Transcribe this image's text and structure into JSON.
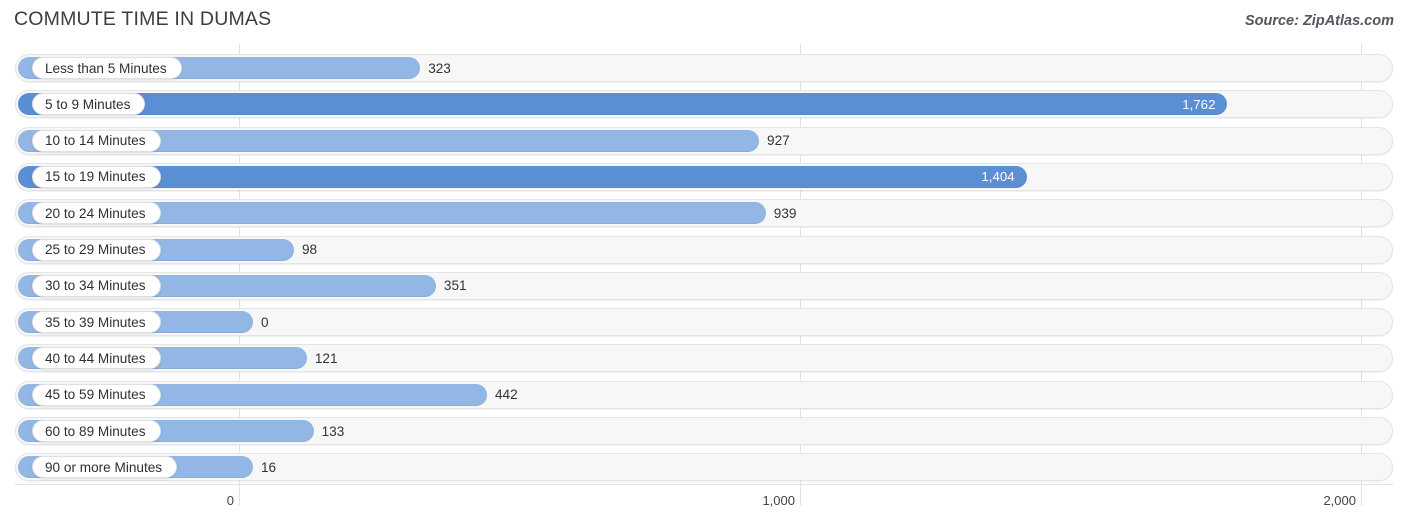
{
  "header": {
    "title": "COMMUTE TIME IN DUMAS",
    "source": "Source: ZipAtlas.com"
  },
  "colors": {
    "bar_light": "#92b7e4",
    "bar_dark": "#5b8fd4",
    "track_bg": "#f7f7f8",
    "track_border": "#e4e4e6",
    "grid": "#e2e2e4",
    "text": "#33333a",
    "title": "#3c3c44"
  },
  "chart_data": {
    "type": "bar",
    "orientation": "horizontal",
    "title": "COMMUTE TIME IN DUMAS",
    "xlabel": "",
    "ylabel": "",
    "xlim": [
      0,
      2000
    ],
    "grid": true,
    "legend": "none",
    "axis_ticks": [
      {
        "value": 0,
        "label": "0"
      },
      {
        "value": 1000,
        "label": "1,000"
      },
      {
        "value": 2000,
        "label": "2,000"
      }
    ],
    "categories": [
      "Less than 5 Minutes",
      "5 to 9 Minutes",
      "10 to 14 Minutes",
      "15 to 19 Minutes",
      "20 to 24 Minutes",
      "25 to 29 Minutes",
      "30 to 34 Minutes",
      "35 to 39 Minutes",
      "40 to 44 Minutes",
      "45 to 59 Minutes",
      "60 to 89 Minutes",
      "90 or more Minutes"
    ],
    "values": [
      323,
      1762,
      927,
      1404,
      939,
      98,
      351,
      0,
      121,
      442,
      133,
      16
    ],
    "value_labels": [
      "323",
      "1,762",
      "927",
      "1,404",
      "939",
      "98",
      "351",
      "0",
      "121",
      "442",
      "133",
      "16"
    ],
    "bars": [
      {
        "label": "Less than 5 Minutes",
        "value": 323,
        "value_label": "323",
        "highlight": false,
        "label_inside": false
      },
      {
        "label": "5 to 9 Minutes",
        "value": 1762,
        "value_label": "1,762",
        "highlight": true,
        "label_inside": true
      },
      {
        "label": "10 to 14 Minutes",
        "value": 927,
        "value_label": "927",
        "highlight": false,
        "label_inside": false
      },
      {
        "label": "15 to 19 Minutes",
        "value": 1404,
        "value_label": "1,404",
        "highlight": true,
        "label_inside": true
      },
      {
        "label": "20 to 24 Minutes",
        "value": 939,
        "value_label": "939",
        "highlight": false,
        "label_inside": false
      },
      {
        "label": "25 to 29 Minutes",
        "value": 98,
        "value_label": "98",
        "highlight": false,
        "label_inside": false
      },
      {
        "label": "30 to 34 Minutes",
        "value": 351,
        "value_label": "351",
        "highlight": false,
        "label_inside": false
      },
      {
        "label": "35 to 39 Minutes",
        "value": 0,
        "value_label": "0",
        "highlight": false,
        "label_inside": false
      },
      {
        "label": "40 to 44 Minutes",
        "value": 121,
        "value_label": "121",
        "highlight": false,
        "label_inside": false
      },
      {
        "label": "45 to 59 Minutes",
        "value": 442,
        "value_label": "442",
        "highlight": false,
        "label_inside": false
      },
      {
        "label": "60 to 89 Minutes",
        "value": 133,
        "value_label": "133",
        "highlight": false,
        "label_inside": false
      },
      {
        "label": "90 or more Minutes",
        "value": 16,
        "value_label": "16",
        "highlight": false,
        "label_inside": false
      }
    ]
  }
}
